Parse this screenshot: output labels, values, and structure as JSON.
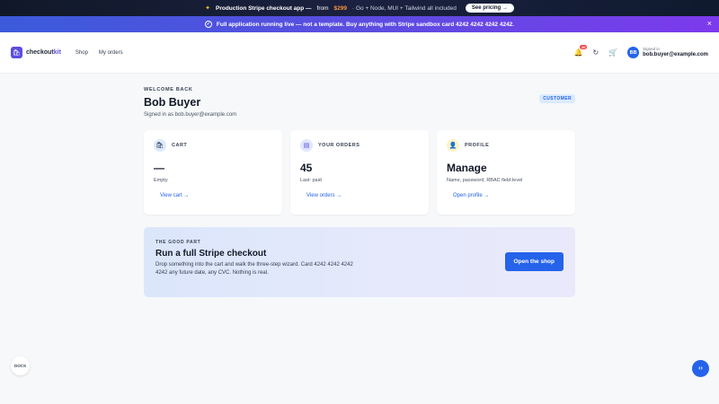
{
  "promo": {
    "spark": "✦",
    "bold_text": "Production Stripe checkout app —",
    "from_text": "from",
    "price": "$299",
    "stack_text": "· Go + Node, MUI + Tailwind all included",
    "button": "See pricing →"
  },
  "notice": {
    "check": "✓",
    "text": "Full application running live — not a template. Buy anything with Stripe sandbox card 4242  4242  4242  4242.",
    "close": "×"
  },
  "nav": {
    "logo_glyph": "🛍",
    "brand_main": "checkout",
    "brand_accent": "kit",
    "links": [
      "Shop",
      "My orders"
    ],
    "bell_icon": "🔔",
    "notifications_count": "20",
    "refresh_icon": "↻",
    "cart_icon": "🛒",
    "user_initials": "BB",
    "user_label": "Signed in",
    "user_email": "bob.buyer@example.com"
  },
  "header": {
    "eyebrow": "WELCOME BACK",
    "title": "Bob Buyer",
    "subtitle": "Signed in as bob.buyer@example.com",
    "role": "CUSTOMER"
  },
  "cards": [
    {
      "icon": "🛍",
      "label": "CART",
      "value": "—",
      "sub": "Empty",
      "link": "View cart →",
      "icon_bg": "#dbeafe"
    },
    {
      "icon": "▤",
      "label": "YOUR ORDERS",
      "value": "45",
      "sub": "Last: paid",
      "link": "View orders →",
      "icon_bg": "#e0e7ff"
    },
    {
      "icon": "👤",
      "label": "PROFILE",
      "value": "Manage",
      "sub": "Name, password, RBAC field-level",
      "link": "Open profile →",
      "icon_bg": "#fef3c7"
    }
  ],
  "cta": {
    "eyebrow": "THE GOOD PART",
    "title": "Run a full Stripe checkout",
    "text": "Drop something into the cart and walk the three-step wizard. Card 4242  4242  4242  4242 any future date, any CVC. Nothing is real.",
    "button": "Open the shop"
  },
  "docs_label": "DOCS",
  "fab_icon": "‹›",
  "colors": {
    "accent": "#2563eb",
    "brand": "#5b4de0",
    "badge": "#ef4444"
  }
}
